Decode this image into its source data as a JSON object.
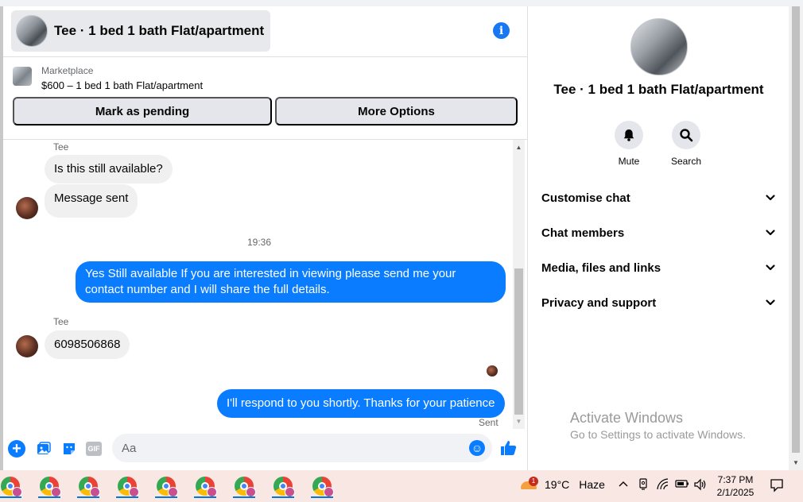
{
  "chat": {
    "title": "Tee · 1 bed 1 bath Flat/apartment",
    "info_icon": "info-icon"
  },
  "listing": {
    "source": "Marketplace",
    "title": "$600 – 1 bed 1 bath Flat/apartment",
    "mark_pending_label": "Mark as pending",
    "more_options_label": "More Options"
  },
  "messages": {
    "sender_1": "Tee",
    "msg_1": "Is this still available?",
    "msg_2": "Message sent",
    "timestamp": "19:36",
    "msg_3": "Yes Still available If you are interested in viewing please send me your contact number and I will share the full details.",
    "sender_2": "Tee",
    "msg_4": "6098506868",
    "msg_5": "I'll respond to you shortly. Thanks for your patience",
    "status": "Sent"
  },
  "composer": {
    "placeholder": "Aa",
    "gif_label": "GIF"
  },
  "panel": {
    "title": "Tee · 1 bed 1 bath Flat/apartment",
    "mute_label": "Mute",
    "search_label": "Search",
    "sections": [
      {
        "label": "Customise chat"
      },
      {
        "label": "Chat members"
      },
      {
        "label": "Media, files and links"
      },
      {
        "label": "Privacy and support"
      }
    ]
  },
  "watermark": {
    "title": "Activate Windows",
    "subtitle": "Go to Settings to activate Windows."
  },
  "taskbar": {
    "app_count": 9,
    "weather_alert_count": "1",
    "temperature": "19°C",
    "condition": "Haze",
    "time": "7:37 PM",
    "date": "2/1/2025"
  },
  "colors": {
    "accent": "#0a7cff",
    "brand": "#1877f2",
    "bubble_in": "#f0f0f0",
    "button_bg": "#e4e6eb",
    "taskbar_bg": "#f9e7e4"
  }
}
